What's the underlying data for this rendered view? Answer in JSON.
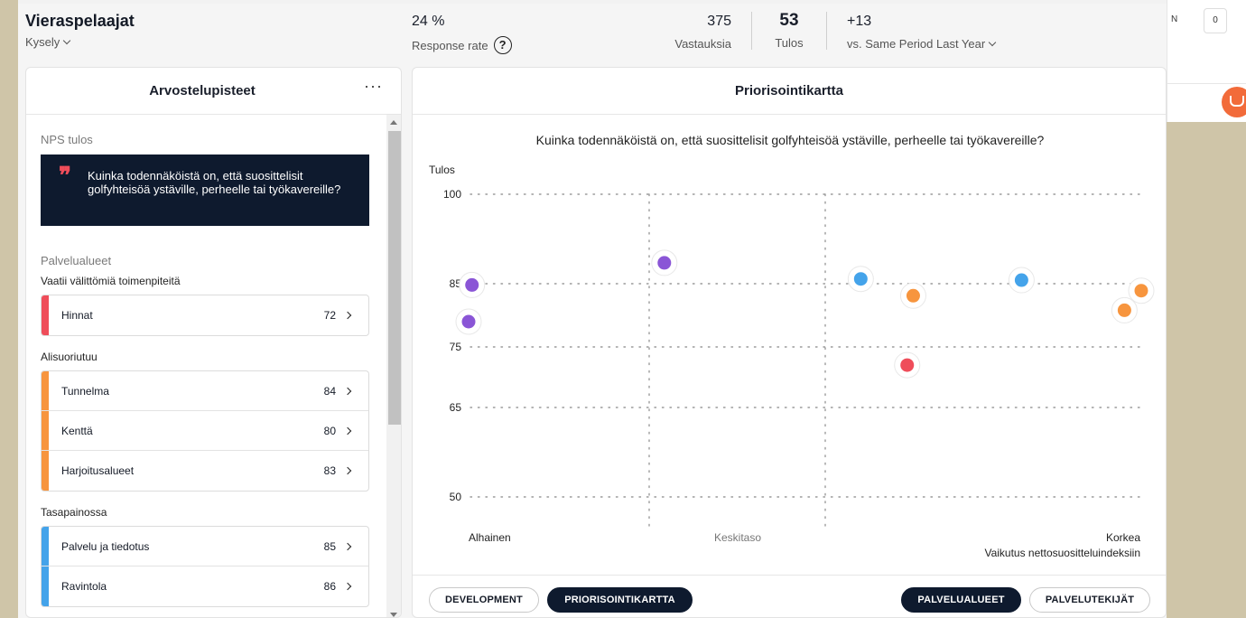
{
  "header": {
    "title": "Vieraspelaajat",
    "subtitle": "Kysely",
    "response_rate_value": "24 %",
    "response_rate_label": "Response rate",
    "help_symbol": "?",
    "responses_value": "375",
    "responses_label": "Vastauksia",
    "score_value": "53",
    "score_label": "Tulos",
    "diff_value": "+13",
    "diff_label": "vs. Same Period Last Year"
  },
  "background": {
    "right_label": "N",
    "right_box": "0"
  },
  "left": {
    "title": "Arvostelupisteet",
    "more": "···",
    "nps_label": "NPS tulos",
    "quote_mark": "❞",
    "quote": "Kuinka todennäköistä on, että suosittelisit golfyhteisöä ystäville, perheelle tai työkavereille?",
    "areas_label": "Palvelualueet",
    "groups": [
      {
        "label": "Vaatii välittömiä toimenpiteitä",
        "color": "#ef4d5a",
        "items": [
          {
            "name": "Hinnat",
            "value": "72"
          }
        ]
      },
      {
        "label": "Alisuoriutuu",
        "color": "#f7953e",
        "items": [
          {
            "name": "Tunnelma",
            "value": "84"
          },
          {
            "name": "Kenttä",
            "value": "80"
          },
          {
            "name": "Harjoitusalueet",
            "value": "83"
          }
        ]
      },
      {
        "label": "Tasapainossa",
        "color": "#44a3ea",
        "items": [
          {
            "name": "Palvelu ja tiedotus",
            "value": "85"
          },
          {
            "name": "Ravintola",
            "value": "86"
          }
        ]
      }
    ]
  },
  "right": {
    "title": "Priorisointikartta",
    "question": "Kuinka todennäköistä on, että suosittelisit golfyhteisöä ystäville, perheelle tai työkavereille?",
    "buttons": {
      "development": "DEVELOPMENT",
      "priority_map": "PRIORISOINTIKARTTA",
      "service_areas": "PALVELUALUEET",
      "service_factors": "PALVELUTEKIJÄT"
    }
  },
  "colors": {
    "purple": "#8a55d6",
    "blue": "#44a3ea",
    "orange": "#f7953e",
    "red": "#ef4d5a",
    "navy": "#0e1a2e"
  },
  "chart_data": {
    "type": "scatter",
    "title": "Kuinka todennäköistä on, että suosittelisit golfyhteisöä ystäville, perheelle tai työkavereille?",
    "ylabel": "Tulos",
    "xlabel": "Vaikutus nettosuositteluindeksiin",
    "x_categories": [
      "Alhainen",
      "Keskitaso",
      "Korkea"
    ],
    "xlim": [
      0,
      1
    ],
    "yticks": [
      100,
      85,
      75,
      65,
      50
    ],
    "ylim": [
      50,
      100
    ],
    "grid": true,
    "points": [
      {
        "x": 0.005,
        "y": 84.8,
        "color": "purple"
      },
      {
        "x": 0.0,
        "y": 79.0,
        "color": "purple"
      },
      {
        "x": 0.291,
        "y": 88.5,
        "color": "purple"
      },
      {
        "x": 0.583,
        "y": 85.8,
        "color": "blue"
      },
      {
        "x": 0.822,
        "y": 85.6,
        "color": "blue"
      },
      {
        "x": 0.661,
        "y": 83.1,
        "color": "orange"
      },
      {
        "x": 1.0,
        "y": 83.9,
        "color": "orange"
      },
      {
        "x": 0.975,
        "y": 80.8,
        "color": "orange"
      },
      {
        "x": 0.652,
        "y": 72.0,
        "color": "red"
      }
    ]
  }
}
